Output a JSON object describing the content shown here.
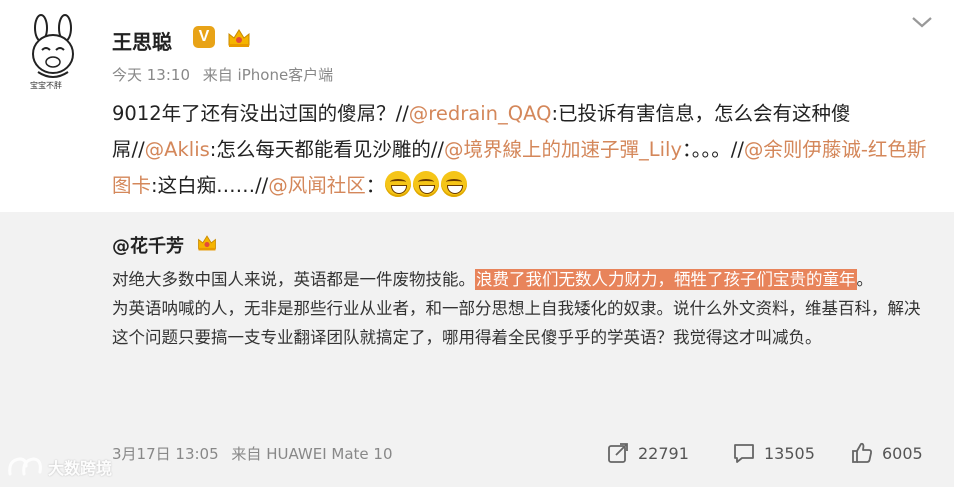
{
  "post": {
    "avatar_caption": "宝宝不胖",
    "username": "王思聪",
    "verified_badge": "V",
    "time": "今天 13:10",
    "source": "来自 iPhone客户端",
    "text_segments": [
      {
        "text": "9012年了还有没出过国的傻屌？//",
        "type": "plain"
      },
      {
        "text": "@redrain_QAQ",
        "type": "mention"
      },
      {
        "text": ":已投诉有害信息，怎么会有这种傻屌//",
        "type": "plain"
      },
      {
        "text": "@Aklis",
        "type": "mention"
      },
      {
        "text": ":怎么每天都能看见沙雕的//",
        "type": "plain"
      },
      {
        "text": "@境界線上的加速子彈_Lily",
        "type": "mention"
      },
      {
        "text": "：。。。//",
        "type": "plain"
      },
      {
        "text": "@余则伊藤诚-红色斯图卡",
        "type": "mention"
      },
      {
        "text": ":这白痴……//",
        "type": "plain"
      },
      {
        "text": "@风闻社区",
        "type": "mention"
      },
      {
        "text": "：",
        "type": "plain"
      }
    ],
    "emoji_count": 3,
    "emoji_name": "grinning-face-emoji"
  },
  "repost": {
    "author": "@花千芳",
    "text_before_highlight": "对绝大多数中国人来说，英语都是一件废物技能。",
    "highlighted_text": "浪费了我们无数人力财力，牺牲了孩子们宝贵的童年",
    "text_after_highlight": "。",
    "second_paragraph": "为英语呐喊的人，无非是那些行业从业者，和一部分思想上自我矮化的奴隶。说什么外文资料，维基百科，解决这个问题只要搞一支专业翻译团队就搞定了，哪用得着全民傻乎乎的学英语？我觉得这才叫减负。",
    "time": "3月17日 13:05",
    "source": "来自 HUAWEI Mate 10",
    "share_count": "22791",
    "comment_count": "13505",
    "like_count": "6005"
  },
  "watermark": {
    "text": "大数跨境"
  },
  "colors": {
    "mention": "#d4875a",
    "highlight": "#e8845b",
    "repost_background": "#f2f2f2",
    "verified": "#e8a317"
  }
}
